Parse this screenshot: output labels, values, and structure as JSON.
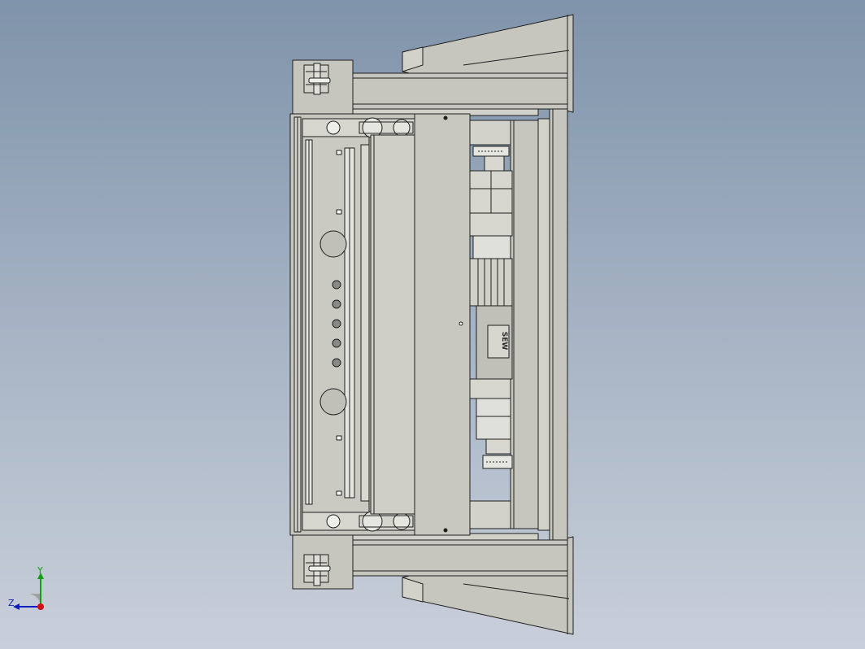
{
  "viewport": {
    "background_top": "#7f93aa",
    "background_bottom": "#c9cfda"
  },
  "model": {
    "fill": "#c6c6be",
    "fill_light": "#d2d2ca",
    "fill_dark": "#a8a8a0",
    "edge": "#1e1e1e",
    "motor_brand_text": "SEW"
  },
  "triad": {
    "x_color": "#d01010",
    "y_color": "#10a010",
    "z_color": "#1020c0",
    "y_label": "Y",
    "z_label": "Z"
  }
}
